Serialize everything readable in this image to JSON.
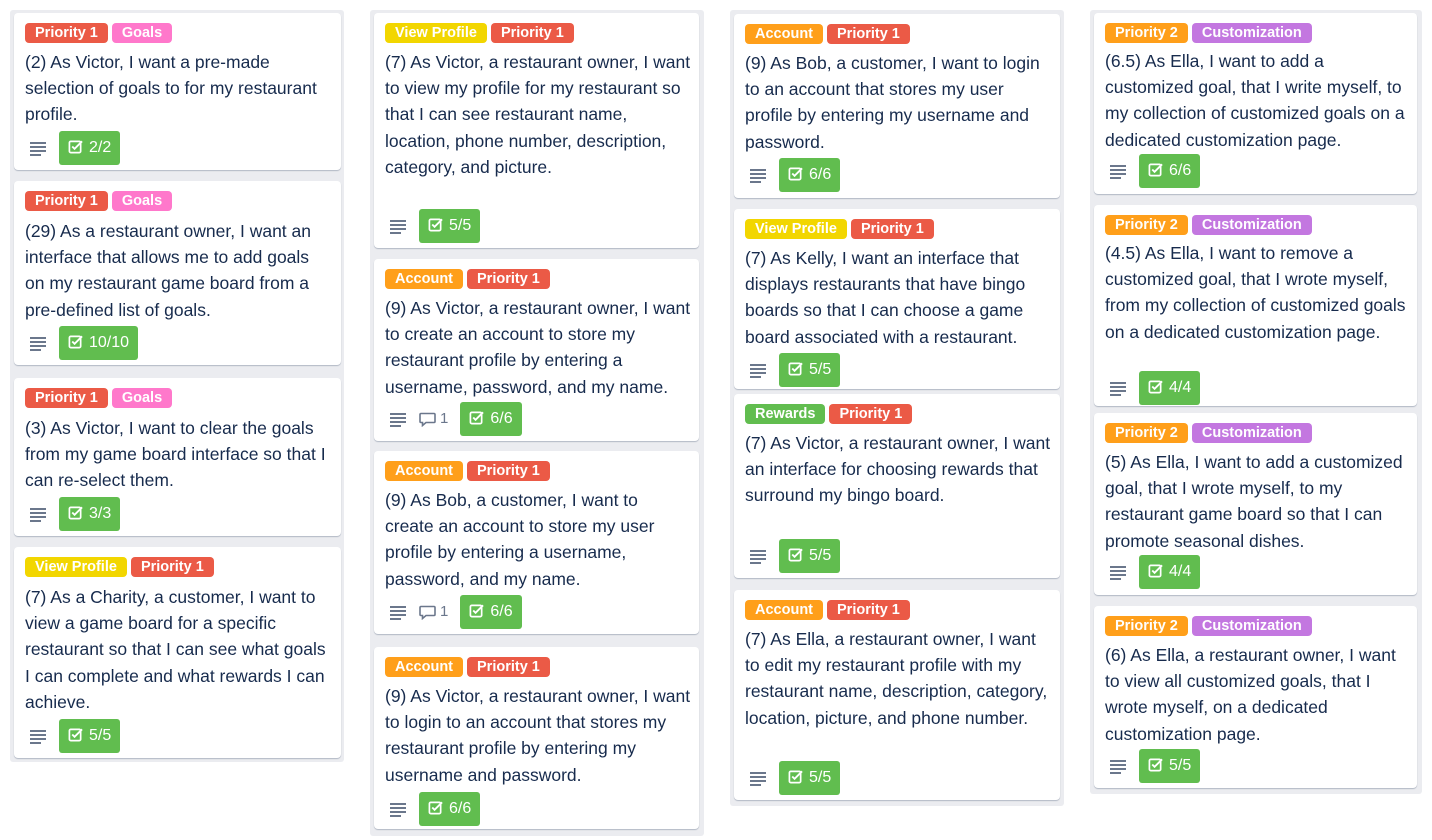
{
  "colors": {
    "priority1": "#eb5a46",
    "priority2": "#ff9f1a",
    "goals": "#ff78cb",
    "account": "#ff9f1a",
    "view_profile": "#f2d600",
    "rewards": "#61bd4f",
    "customization": "#c377e0",
    "checklist_complete": "#61bd4f"
  },
  "icons": {
    "description": "description-icon",
    "comment": "comment-icon",
    "checklist": "checklist-icon"
  },
  "columns": [
    {
      "cards": [
        {
          "labels": [
            "Priority 1",
            "Goals"
          ],
          "title": "(2) As Victor, I want a pre-made selection of goals to for my restaurant profile.",
          "checklist": "2/2"
        },
        {
          "labels": [
            "Priority 1",
            "Goals"
          ],
          "title": "(29) As a restaurant owner, I want an interface that allows me to add goals on my restaurant game board from a pre-defined list of goals.",
          "checklist": "10/10"
        },
        {
          "labels": [
            "Priority 1",
            "Goals"
          ],
          "title": "(3) As Victor, I want to clear the goals from my game board interface so that I can re-select them.",
          "checklist": "3/3"
        },
        {
          "labels": [
            "View Profile",
            "Priority 1"
          ],
          "title": "(7) As a Charity, a customer, I want to view a game board for a specific restaurant so that I can see what goals I can complete and what rewards I can achieve.",
          "checklist": "5/5"
        }
      ]
    },
    {
      "cards": [
        {
          "labels": [
            "View Profile",
            "Priority 1"
          ],
          "title": "(7) As Victor, a restaurant owner, I want to view my profile for my restaurant so that I can see restaurant name, location, phone number, description, category, and picture.",
          "checklist": "5/5"
        },
        {
          "labels": [
            "Account",
            "Priority 1"
          ],
          "title": "(9) As Victor, a restaurant owner, I want to create an account to store my restaurant profile by entering a username, password, and my name.",
          "comments": "1",
          "checklist": "6/6"
        },
        {
          "labels": [
            "Account",
            "Priority 1"
          ],
          "title": "(9) As Bob, a customer, I want to create an account to store my user profile by entering a username, password, and my name.",
          "comments": "1",
          "checklist": "6/6"
        },
        {
          "labels": [
            "Account",
            "Priority 1"
          ],
          "title": "(9) As Victor, a restaurant owner, I want to login to an account that stores my restaurant profile by entering my username and password.",
          "checklist": "6/6"
        }
      ]
    },
    {
      "cards": [
        {
          "labels": [
            "Account",
            "Priority 1"
          ],
          "title": "(9) As Bob, a customer, I want to login to an account that stores my user profile by entering my username and password.",
          "checklist": "6/6"
        },
        {
          "labels": [
            "View Profile",
            "Priority 1"
          ],
          "title": "(7) As Kelly, I want an interface that displays restaurants that have bingo boards so that I can choose a game board associated with a restaurant.",
          "checklist": "5/5"
        },
        {
          "labels": [
            "Rewards",
            "Priority 1"
          ],
          "title": "(7) As Victor, a restaurant owner, I want an interface for choosing rewards that surround my bingo board.",
          "checklist": "5/5"
        },
        {
          "labels": [
            "Account",
            "Priority 1"
          ],
          "title": "(7) As Ella, a restaurant owner, I want to edit my restaurant profile with my restaurant name, description, category, location, picture, and phone number.",
          "checklist": "5/5"
        }
      ]
    },
    {
      "cards": [
        {
          "labels": [
            "Priority 2",
            "Customization"
          ],
          "title": "(6.5) As Ella, I want to add a customized goal, that I write myself, to my collection of customized goals on a dedicated customization page.",
          "checklist": "6/6"
        },
        {
          "labels": [
            "Priority 2",
            "Customization"
          ],
          "title": "(4.5) As Ella, I want to remove a customized goal, that I wrote myself, from my collection of customized goals on a dedicated customization page.",
          "checklist": "4/4"
        },
        {
          "labels": [
            "Priority 2",
            "Customization"
          ],
          "title": "(5) As Ella, I want to add a customized goal, that I wrote myself, to my restaurant game board so that I can promote seasonal dishes.",
          "checklist": "4/4"
        },
        {
          "labels": [
            "Priority 2",
            "Customization"
          ],
          "title": "(6) As Ella, a restaurant owner, I want to view all customized goals, that I wrote myself, on a dedicated customization page.",
          "checklist": "5/5"
        }
      ]
    }
  ]
}
